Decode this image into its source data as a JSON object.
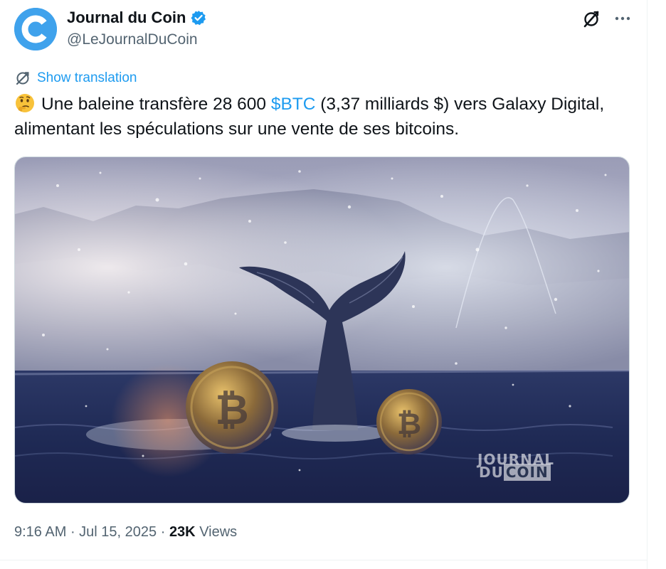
{
  "author": {
    "display_name": "Journal du Coin",
    "handle": "@LeJournalDuCoin",
    "verified": true
  },
  "icons": {
    "avatar": "journal-du-coin-logo",
    "verified": "verified-badge-icon",
    "grok": "grok-icon",
    "more": "more-dots-icon",
    "translate": "translate-globe-icon",
    "emoji": "thinking-face-emoji"
  },
  "colors": {
    "accent": "#1d9bf0",
    "text": "#0f1419",
    "secondary": "#536471",
    "avatar_bg": "#3fa2ec"
  },
  "translation": {
    "label": "Show translation"
  },
  "tweet": {
    "emoji": "🤔",
    "text_before": "Une baleine transfère 28 600 ",
    "cashtag": "$BTC",
    "text_after": " (3,37 milliards $) vers Galaxy Digital, alimentant les spéculations sur une vente de ses bitcoins."
  },
  "media": {
    "watermark_line1": "JOURNAL",
    "watermark_line2_prefix": "DU",
    "watermark_line2_box": "COIN"
  },
  "meta": {
    "time": "9:16 AM",
    "separator": " · ",
    "date": "Jul 15, 2025",
    "views_count": "23K",
    "views_label": " Views"
  }
}
